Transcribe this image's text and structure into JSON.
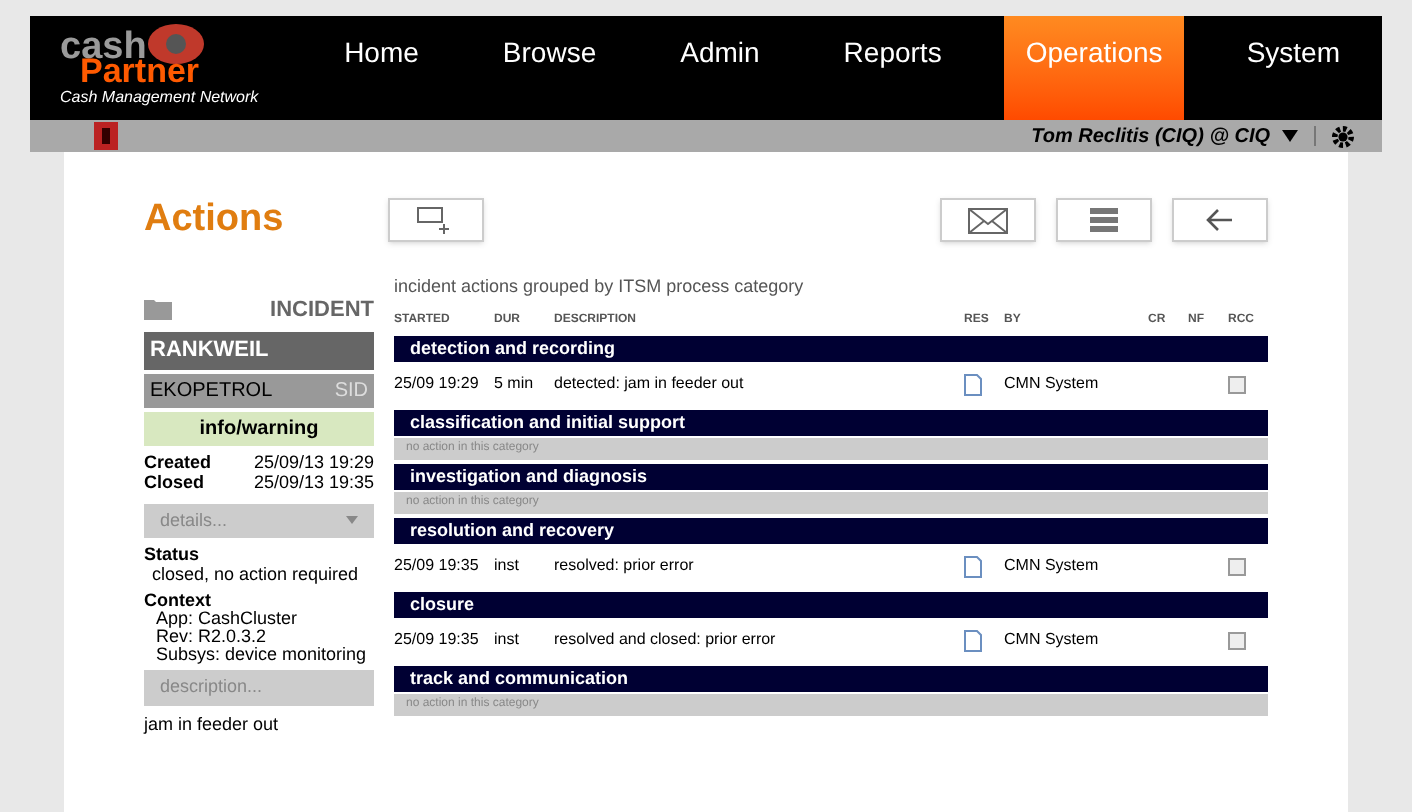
{
  "logo": {
    "word_1": "cash",
    "word_2": "Partner",
    "tagline": "Cash Management Network"
  },
  "nav": [
    {
      "label": "Home",
      "selected": false
    },
    {
      "label": "Browse",
      "selected": false
    },
    {
      "label": "Admin",
      "selected": false
    },
    {
      "label": "Reports",
      "selected": false
    },
    {
      "label": "Operations",
      "selected": true
    },
    {
      "label": "System",
      "selected": false
    }
  ],
  "user": "Tom Reclitis (CIQ) @ CIQ",
  "page_title": "Actions",
  "incident": {
    "heading": "INCIDENT",
    "location": "RANKWEIL",
    "customer": "EKOPETROL",
    "sid": "SID",
    "severity": "info/warning",
    "created_label": "Created",
    "created": "25/09/13 19:29",
    "closed_label": "Closed",
    "closed": "25/09/13 19:35",
    "details": "details...",
    "status_label": "Status",
    "status": "closed, no action required",
    "context_label": "Context",
    "context": [
      "App: CashCluster",
      "Rev: R2.0.3.2",
      "Subsys: device monitoring"
    ],
    "description_button": "description...",
    "description": "jam in feeder out"
  },
  "table": {
    "caption": "incident actions grouped by ITSM process category",
    "columns": [
      "STARTED",
      "DUR",
      "DESCRIPTION",
      "RES",
      "BY",
      "CR",
      "NF",
      "RCC"
    ],
    "groups": [
      {
        "title": "detection and recording",
        "rows": [
          {
            "started": "25/09 19:29",
            "dur": "5 min",
            "description": "detected: jam in feeder out",
            "by": "CMN System",
            "checked": false
          }
        ]
      },
      {
        "title": "classification and initial support",
        "empty": "no action in this category"
      },
      {
        "title": "investigation and diagnosis",
        "empty": "no action in this category"
      },
      {
        "title": "resolution and recovery",
        "rows": [
          {
            "started": "25/09 19:35",
            "dur": "inst",
            "description": "resolved: prior error",
            "by": "CMN System",
            "checked": false
          }
        ]
      },
      {
        "title": "closure",
        "rows": [
          {
            "started": "25/09 19:35",
            "dur": "inst",
            "description": "resolved and closed: prior error",
            "by": "CMN System",
            "checked": false
          }
        ]
      },
      {
        "title": "track and communication",
        "empty": "no action in this category"
      }
    ]
  }
}
